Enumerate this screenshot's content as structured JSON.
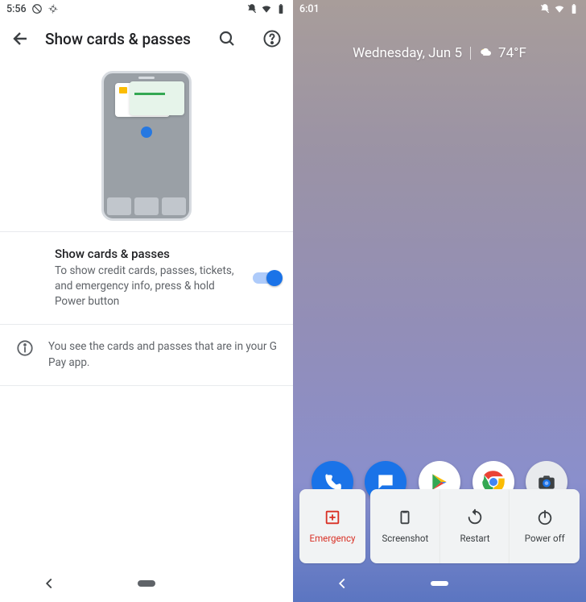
{
  "left": {
    "status_time": "5:56",
    "header_title": "Show cards & passes",
    "toggle_title": "Show cards & passes",
    "toggle_desc": "To show credit cards, passes, tickets, and emergency info, press & hold Power button",
    "info_text": "You see the cards and passes that are in your G Pay app."
  },
  "right": {
    "status_time": "6:01",
    "date_text": "Wednesday, Jun 5",
    "temp_text": "74°F",
    "power": {
      "emergency": "Emergency",
      "screenshot": "Screenshot",
      "restart": "Restart",
      "poweroff": "Power off"
    }
  }
}
